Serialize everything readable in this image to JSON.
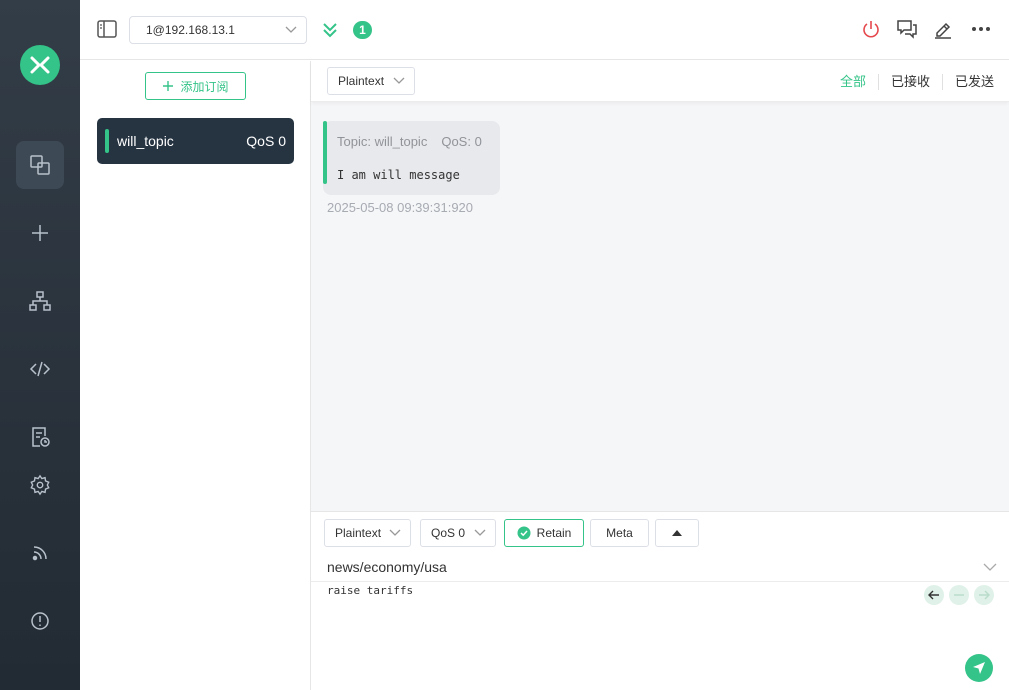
{
  "theme": {
    "accent": "#34c388",
    "sidebar_bg": "#2a323c",
    "danger": "#e5484d"
  },
  "sidebar": {
    "logo_icon": "mqttx-logo-icon",
    "items": [
      {
        "name": "connections",
        "icon": "connections-icon",
        "active": true
      },
      {
        "name": "new-connection",
        "icon": "plus-icon"
      },
      {
        "name": "topic-tree",
        "icon": "sitemap-icon"
      },
      {
        "name": "scripts",
        "icon": "code-icon"
      },
      {
        "name": "logs",
        "icon": "log-icon"
      },
      {
        "name": "settings",
        "icon": "gear-icon"
      },
      {
        "name": "subscriptions",
        "icon": "rss-icon"
      },
      {
        "name": "about",
        "icon": "info-icon"
      }
    ]
  },
  "header": {
    "connection": "1@192.168.13.1",
    "unread_count": "1",
    "actions": [
      "disconnect-icon",
      "chat-icon",
      "edit-icon",
      "more-icon"
    ]
  },
  "subscriptions": {
    "add_label": "添加订阅",
    "items": [
      {
        "topic": "will_topic",
        "qos": "QoS 0",
        "color": "#34c388"
      }
    ]
  },
  "messages": {
    "format": "Plaintext",
    "tabs": [
      "全部",
      "已接收",
      "已发送"
    ],
    "active_tab": "全部",
    "list": [
      {
        "topic_label": "Topic: will_topic",
        "qos_label": "QoS: 0",
        "payload": "I am will message",
        "time": "2025-05-08 09:39:31:920"
      }
    ]
  },
  "publish": {
    "format": "Plaintext",
    "qos": "QoS 0",
    "retain_label": "Retain",
    "retain_checked": true,
    "meta_label": "Meta",
    "topic": "news/economy/usa",
    "payload": "raise tariffs"
  }
}
